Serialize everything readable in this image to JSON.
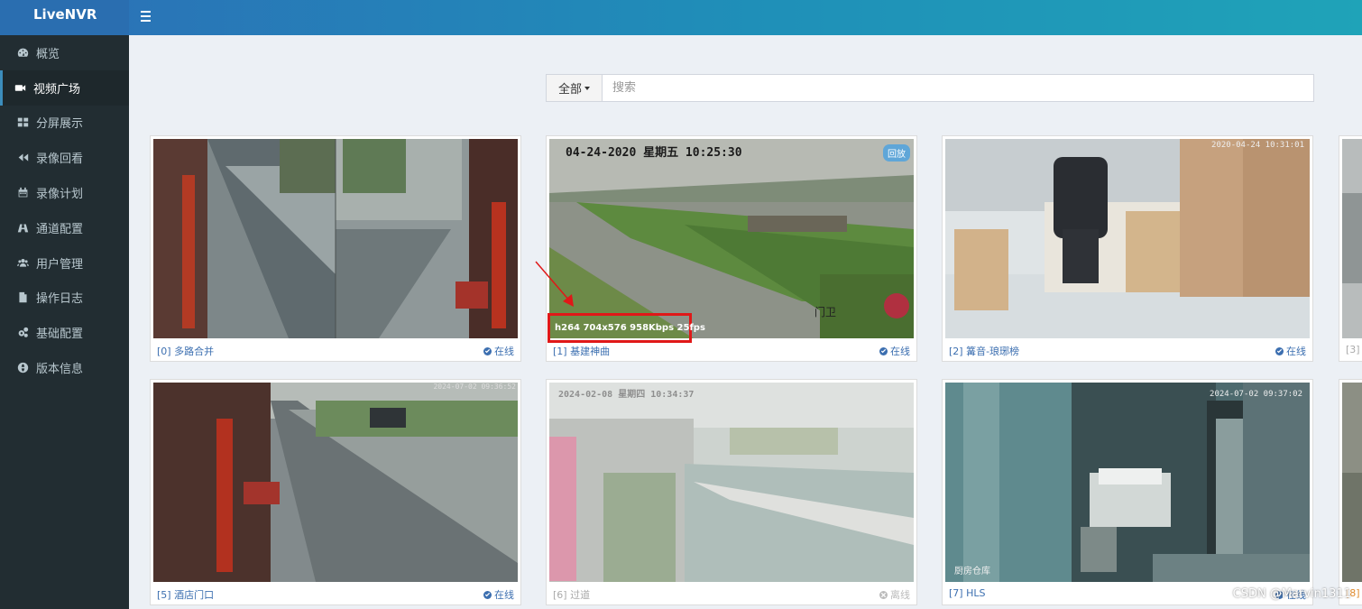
{
  "app": {
    "title": "LiveNVR"
  },
  "sidebar": {
    "items": [
      {
        "label": "概览",
        "icon": "dashboard-icon"
      },
      {
        "label": "视频广场",
        "icon": "video-camera-icon",
        "active": true
      },
      {
        "label": "分屏展示",
        "icon": "grid-icon"
      },
      {
        "label": "录像回看",
        "icon": "rewind-icon"
      },
      {
        "label": "录像计划",
        "icon": "calendar-icon"
      },
      {
        "label": "通道配置",
        "icon": "channel-icon"
      },
      {
        "label": "用户管理",
        "icon": "users-icon"
      },
      {
        "label": "操作日志",
        "icon": "file-icon"
      },
      {
        "label": "基础配置",
        "icon": "gears-icon"
      },
      {
        "label": "版本信息",
        "icon": "globe-icon"
      }
    ]
  },
  "search": {
    "filter_label": "全部",
    "placeholder": "搜索",
    "value": ""
  },
  "cards": [
    {
      "caption": "[0] 多路合并",
      "status": "在线",
      "online": true
    },
    {
      "caption": "[1] 基建神曲",
      "status": "在线",
      "online": true,
      "badge": "回放",
      "osd": "04-24-2020  星期五  10:25:30",
      "stream_info": "h264 704x576 958Kbps 25fps",
      "overlay_text": "门卫"
    },
    {
      "caption": "[2] 篝音-琅琊榜",
      "status": "在线",
      "online": true,
      "osd": "2020-04-24  10:31:01"
    },
    {
      "caption": "[3]",
      "status": "",
      "online": true
    },
    {
      "caption": "[5] 酒店门口",
      "status": "在线",
      "online": true,
      "osd": "2024-07-02 09:36:52"
    },
    {
      "caption": "[6] 过道",
      "status": "离线",
      "online": false,
      "osd": "2024-02-08  星期四  10:34:37"
    },
    {
      "caption": "[7] HLS",
      "status": "在线",
      "online": true,
      "osd": "2024-07-02 09:37:02",
      "overlay_text": "厨房仓库"
    },
    {
      "caption": "[8]",
      "status": "",
      "online": true
    }
  ],
  "watermark": "CSDN @Marvin1311",
  "colors": {
    "header": "#2a6eb0",
    "sidebar": "#222d32",
    "link": "#3c6fb0",
    "highlight": "#e01818"
  }
}
